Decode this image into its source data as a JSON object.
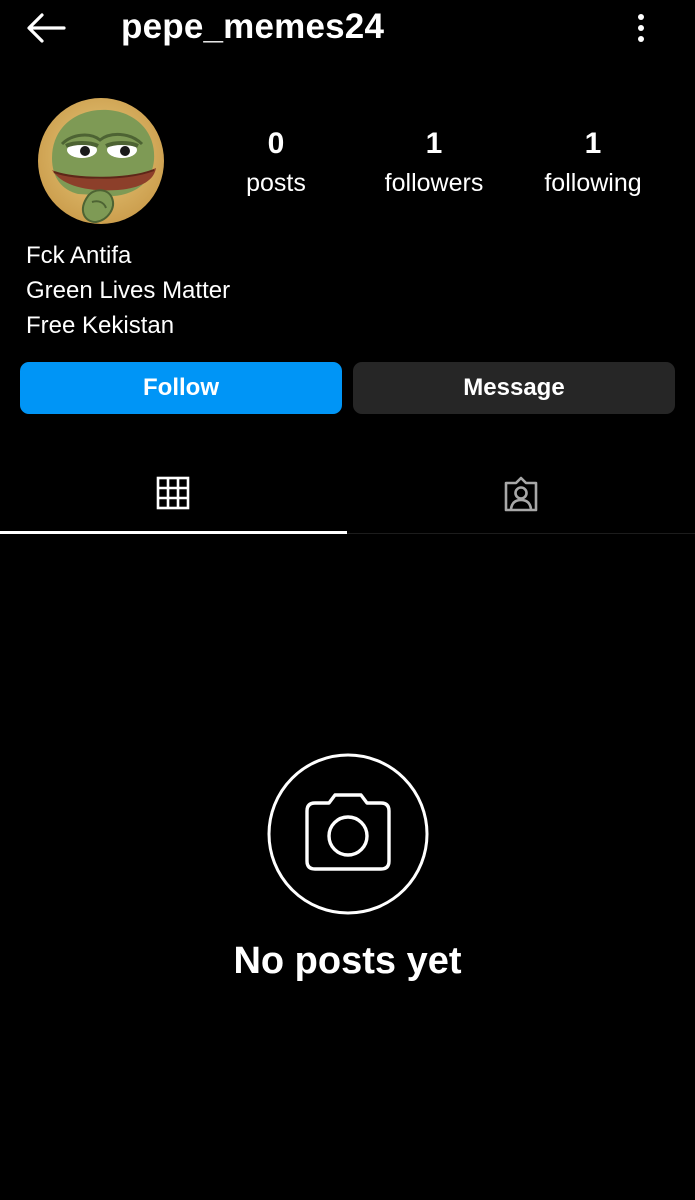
{
  "header": {
    "username": "pepe_memes24"
  },
  "profile": {
    "stats": [
      {
        "value": "0",
        "label": "posts"
      },
      {
        "value": "1",
        "label": "followers"
      },
      {
        "value": "1",
        "label": "following"
      }
    ],
    "bio": [
      "Fck Antifa",
      "Green Lives Matter",
      "Free Kekistan"
    ]
  },
  "actions": {
    "follow_label": "Follow",
    "message_label": "Message"
  },
  "tabs": {
    "active": "grid",
    "items": [
      "grid",
      "tagged"
    ]
  },
  "empty_state": {
    "title": "No posts yet"
  },
  "colors": {
    "background": "#000000",
    "accent": "#0095f6",
    "secondary_button": "#262626",
    "text": "#ffffff"
  }
}
